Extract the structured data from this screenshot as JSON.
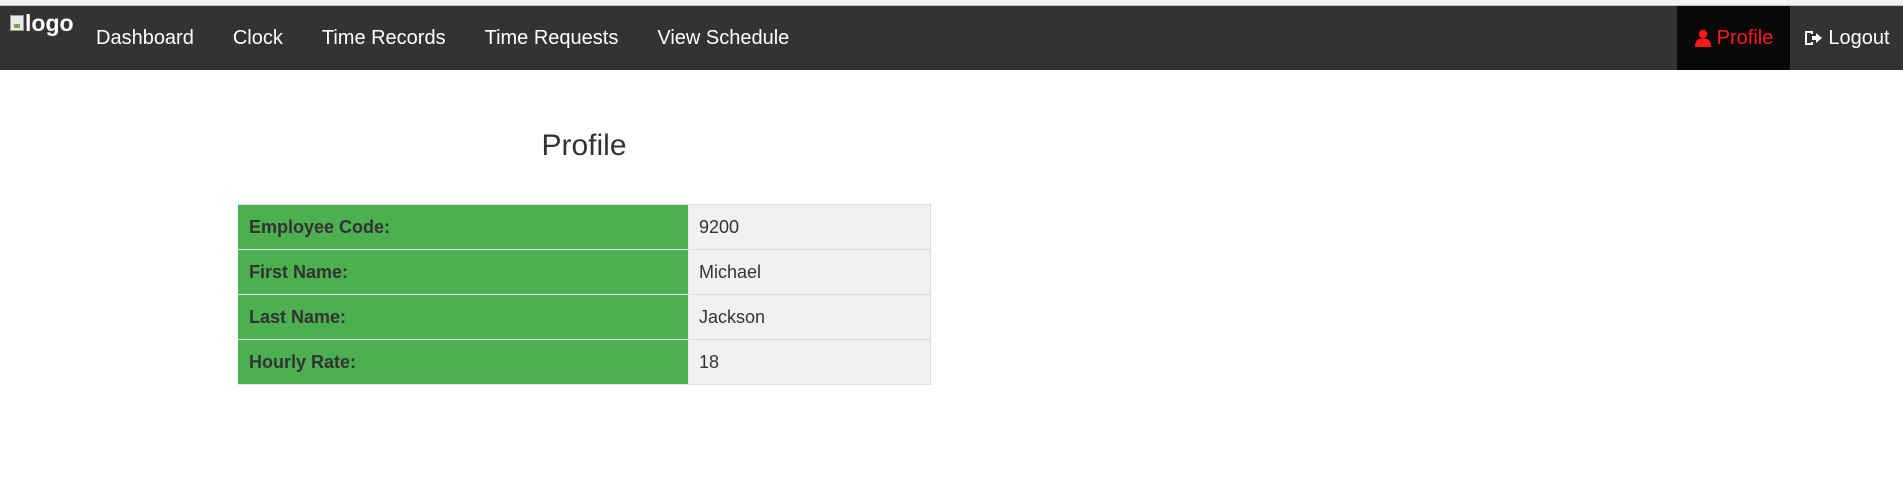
{
  "navbar": {
    "logo_alt": "logo",
    "items": [
      {
        "label": "Dashboard"
      },
      {
        "label": "Clock"
      },
      {
        "label": "Time Records"
      },
      {
        "label": "Time Requests"
      },
      {
        "label": "View Schedule"
      }
    ],
    "profile_label": "Profile",
    "logout_label": "Logout",
    "active_color": "#ff1a1a",
    "background_color": "#333333"
  },
  "page": {
    "title": "Profile"
  },
  "profile": {
    "rows": [
      {
        "label": "Employee Code:",
        "value": "9200"
      },
      {
        "label": "First Name:",
        "value": "Michael"
      },
      {
        "label": "Last Name:",
        "value": "Jackson"
      },
      {
        "label": "Hourly Rate:",
        "value": "18"
      }
    ],
    "label_color": "#4caf50"
  }
}
